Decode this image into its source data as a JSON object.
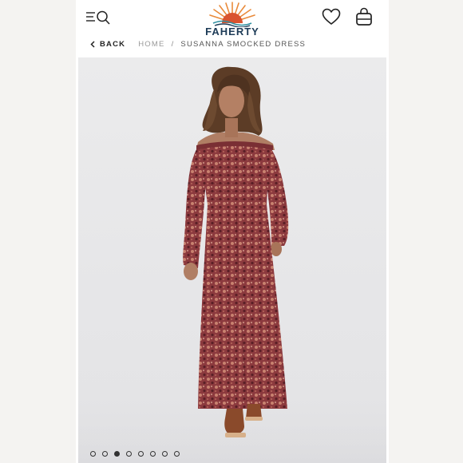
{
  "brand": {
    "logo_text": "FAHERTY"
  },
  "breadcrumb": {
    "back_label": "BACK",
    "home_label": "HOME",
    "separator": "/",
    "current_label": "SUSANNA SMOCKED DRESS"
  },
  "icons": {
    "menu": "menu-icon",
    "search": "search-icon",
    "wishlist": "heart-icon",
    "bag": "shopping-bag-icon",
    "back": "chevron-left-icon"
  },
  "gallery": {
    "total_images": 8,
    "active_index": 2
  },
  "colors": {
    "brand_navy": "#1d3b57",
    "sun_orange": "#e98a3a",
    "dress": "#8c3a3e"
  }
}
